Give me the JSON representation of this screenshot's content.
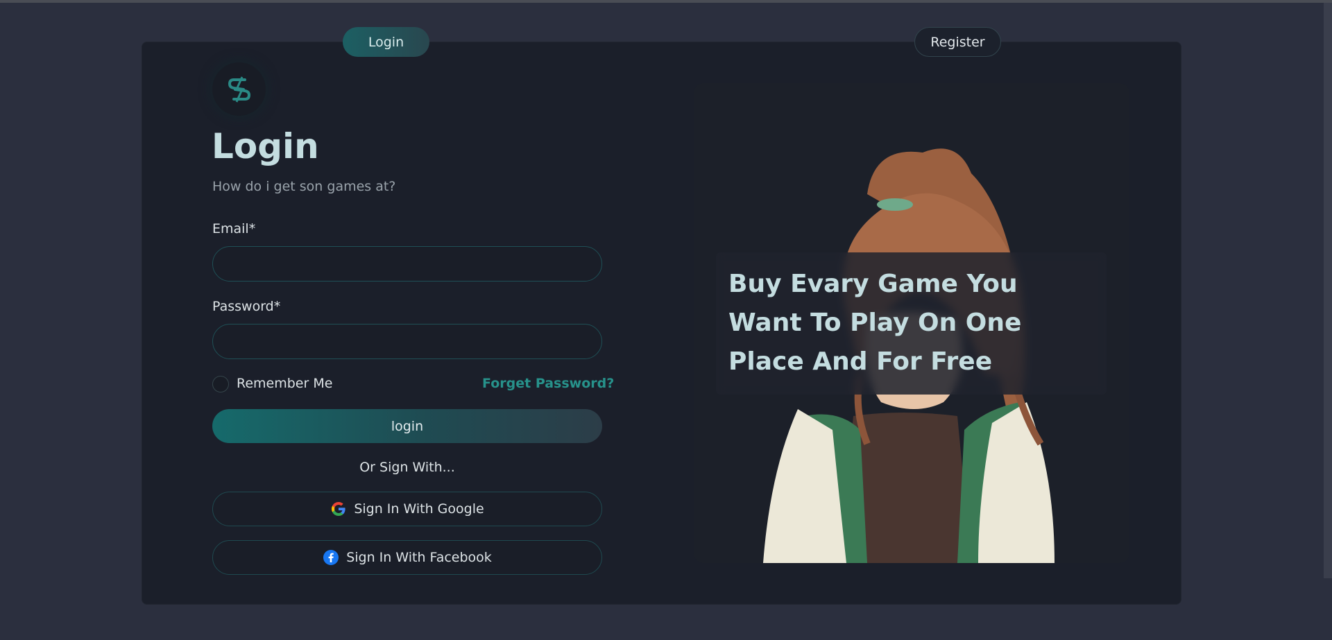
{
  "tabs": {
    "login_label": "Login",
    "register_label": "Register"
  },
  "form": {
    "title": "Login",
    "subtitle": "How do i get son games at?",
    "email_label": "Email*",
    "email_value": "",
    "password_label": "Password*",
    "password_value": "",
    "remember_label": "Remember Me",
    "forgot_label": "Forget Password?",
    "login_button": "login",
    "or_text": "Or Sign With...",
    "google_button": "Sign In With Google",
    "facebook_button": "Sign In With Facebook"
  },
  "hero": {
    "text": "Buy Evary Game You Want To Play On One Place And For Free"
  },
  "colors": {
    "background": "#2b2f3e",
    "card": "#1b1f2a",
    "accent": "#27928b",
    "title": "#c4dde0"
  },
  "icons": {
    "logo": "brand-logo-icon",
    "google": "google-icon",
    "facebook": "facebook-icon"
  }
}
